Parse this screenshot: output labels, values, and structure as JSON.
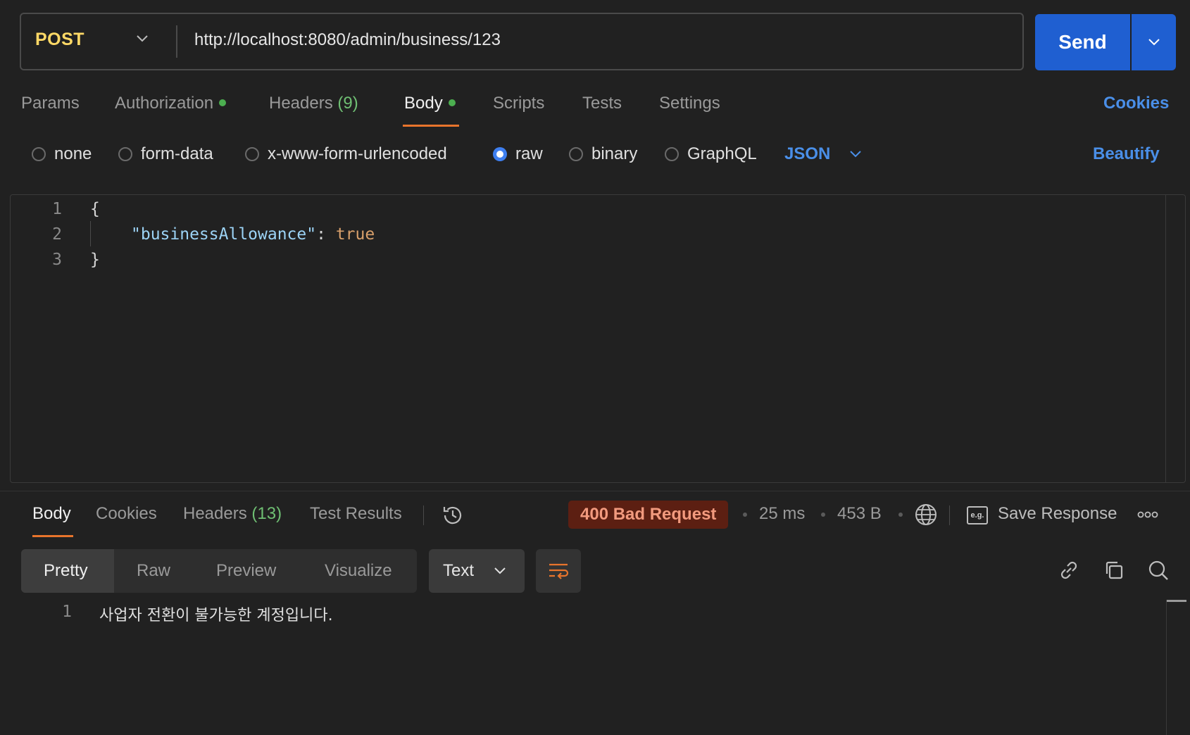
{
  "request": {
    "method": "POST",
    "url": "http://localhost:8080/admin/business/123",
    "send_label": "Send"
  },
  "request_tabs": {
    "params": "Params",
    "authorization": "Authorization",
    "headers": "Headers",
    "headers_count": "(9)",
    "body": "Body",
    "scripts": "Scripts",
    "tests": "Tests",
    "settings": "Settings",
    "cookies": "Cookies"
  },
  "body_types": {
    "none": "none",
    "form_data": "form-data",
    "urlencoded": "x-www-form-urlencoded",
    "raw": "raw",
    "binary": "binary",
    "graphql": "GraphQL",
    "language": "JSON",
    "beautify": "Beautify"
  },
  "editor": {
    "lines": [
      "1",
      "2",
      "3"
    ],
    "open_brace": "{",
    "key": "\"businessAllowance\"",
    "colon": ":",
    "value": "true",
    "close_brace": "}"
  },
  "response_tabs": {
    "body": "Body",
    "cookies": "Cookies",
    "headers": "Headers",
    "headers_count": "(13)",
    "test_results": "Test Results"
  },
  "response_meta": {
    "status": "400 Bad Request",
    "time": "25 ms",
    "size": "453 B",
    "save_response": "Save Response",
    "eg_badge": "e.g."
  },
  "format": {
    "pretty": "Pretty",
    "raw": "Raw",
    "preview": "Preview",
    "visualize": "Visualize",
    "text": "Text"
  },
  "response_body": {
    "line_number": "1",
    "text": "사업자 전환이 불가능한 계정입니다."
  },
  "colors": {
    "accent_orange": "#e8742c",
    "send_blue": "#1f5fd1",
    "link_blue": "#4a8fe8",
    "method_yellow": "#ffd966",
    "status_error_bg": "#5c1f12"
  }
}
